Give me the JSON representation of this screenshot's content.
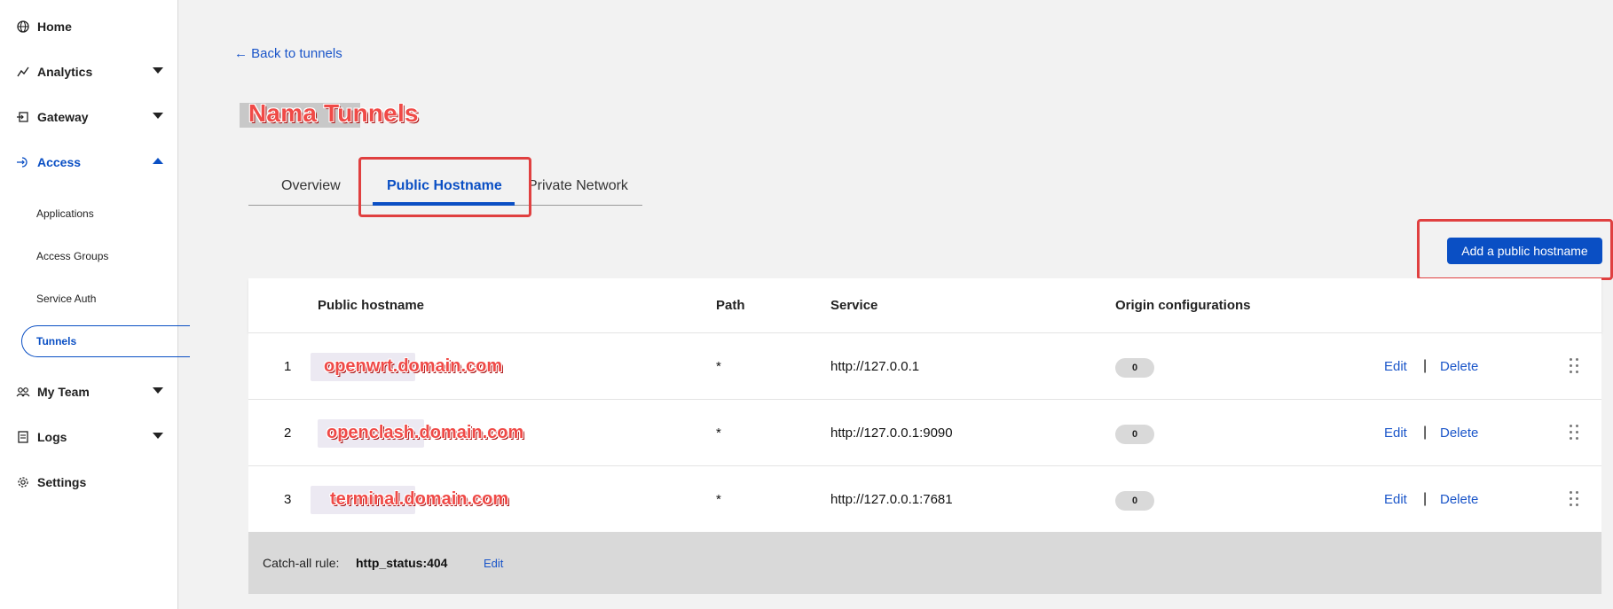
{
  "sidebar": {
    "items": [
      {
        "label": "Home",
        "icon": "globe-icon"
      },
      {
        "label": "Analytics",
        "icon": "analytics-icon"
      },
      {
        "label": "Gateway",
        "icon": "gateway-icon"
      },
      {
        "label": "Access",
        "icon": "access-icon"
      },
      {
        "label": "My Team",
        "icon": "team-icon"
      },
      {
        "label": "Logs",
        "icon": "logs-icon"
      },
      {
        "label": "Settings",
        "icon": "gear-icon"
      }
    ],
    "access_sub": [
      "Applications",
      "Access Groups",
      "Service Auth",
      "Tunnels"
    ]
  },
  "back_link": "← Back to tunnels",
  "page_title": "Nama Tunnels",
  "tabs": [
    {
      "label": "Overview"
    },
    {
      "label": "Public Hostname"
    },
    {
      "label": "Private Network"
    }
  ],
  "add_button": "Add a public hostname",
  "table": {
    "headers": [
      "Public hostname",
      "Path",
      "Service",
      "Origin configurations"
    ],
    "rows": [
      {
        "num": "1",
        "hostname": "openwrt.domain.com",
        "path": "*",
        "service": "http://127.0.0.1",
        "origin": "0"
      },
      {
        "num": "2",
        "hostname": "openclash.domain.com",
        "path": "*",
        "service": "http://127.0.0.1:9090",
        "origin": "0"
      },
      {
        "num": "3",
        "hostname": "terminal.domain.com",
        "path": "*",
        "service": "http://127.0.0.1:7681",
        "origin": "0"
      }
    ],
    "edit_label": "Edit",
    "separator": "|",
    "delete_label": "Delete"
  },
  "catch_all": {
    "label": "Catch-all rule:",
    "value": "http_status:404",
    "edit": "Edit"
  },
  "colors": {
    "accent": "#0a4fc4",
    "annotation_red": "#e04040",
    "footer_bg": "#d9d9d9"
  }
}
